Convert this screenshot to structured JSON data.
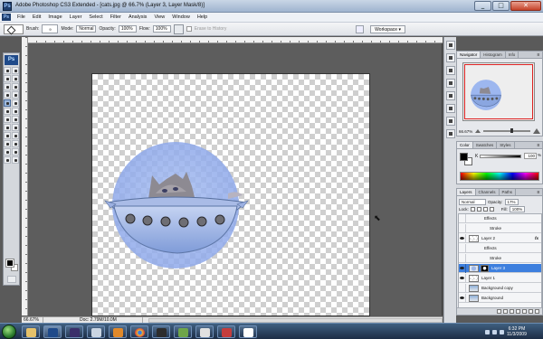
{
  "window": {
    "title": "Adobe Photoshop CS3 Extended - [cats.jpg @ 66.7% (Layer 3, Layer Mask/8)]",
    "app_icon": "Ps",
    "controls": [
      "_",
      "□",
      "✕"
    ]
  },
  "menu": {
    "items": [
      "File",
      "Edit",
      "Image",
      "Layer",
      "Select",
      "Filter",
      "Analysis",
      "View",
      "Window",
      "Help"
    ]
  },
  "options": {
    "brush_label": "Brush:",
    "brush_size": "9",
    "mode_label": "Mode:",
    "mode_value": "Normal",
    "opacity_label": "Opacity:",
    "opacity_value": "100%",
    "flow_label": "Flow:",
    "flow_value": "100%",
    "erase_to_history": "Erase to History",
    "workspace": "Workspace ▾"
  },
  "tools": {
    "logo": "Ps",
    "count": 24,
    "active_index": 8
  },
  "document": {
    "zoom": "66.67%",
    "doc_info": "Doc: 2.79M/10.0M"
  },
  "navigator": {
    "tabs": [
      "Navigator",
      "Histogram",
      "Info"
    ],
    "zoom": "66.67%"
  },
  "color": {
    "tabs": [
      "Color",
      "Swatches",
      "Styles"
    ],
    "channel": "K",
    "value": "100",
    "unit": "%"
  },
  "layers": {
    "tabs": [
      "Layers",
      "Channels",
      "Paths"
    ],
    "blend_mode": "Normal",
    "opacity_label": "Opacity:",
    "opacity_value": "17%",
    "lock_label": "Lock:",
    "fill_label": "Fill:",
    "fill_value": "100%",
    "rows": [
      {
        "name": "Effects",
        "kind": "sub",
        "visible": false
      },
      {
        "name": "Stroke",
        "kind": "sub2",
        "visible": false
      },
      {
        "name": "Layer 2",
        "kind": "layer",
        "visible": true,
        "fx": "fx"
      },
      {
        "name": "Effects",
        "kind": "sub",
        "visible": false
      },
      {
        "name": "Stroke",
        "kind": "sub2",
        "visible": false
      },
      {
        "name": "Layer 3",
        "kind": "layer",
        "visible": true,
        "selected": true
      },
      {
        "name": "Layer 1",
        "kind": "layer",
        "visible": true
      },
      {
        "name": "Background copy",
        "kind": "layer",
        "visible": false
      },
      {
        "name": "Background",
        "kind": "layer",
        "visible": true
      }
    ]
  },
  "taskbar": {
    "time": "6:32 PM",
    "date": "11/3/2009"
  },
  "colors": {
    "accent": "#3d7fde",
    "bowl_blue": "#8aa8e6",
    "circle_blue": "#9db7ef"
  }
}
